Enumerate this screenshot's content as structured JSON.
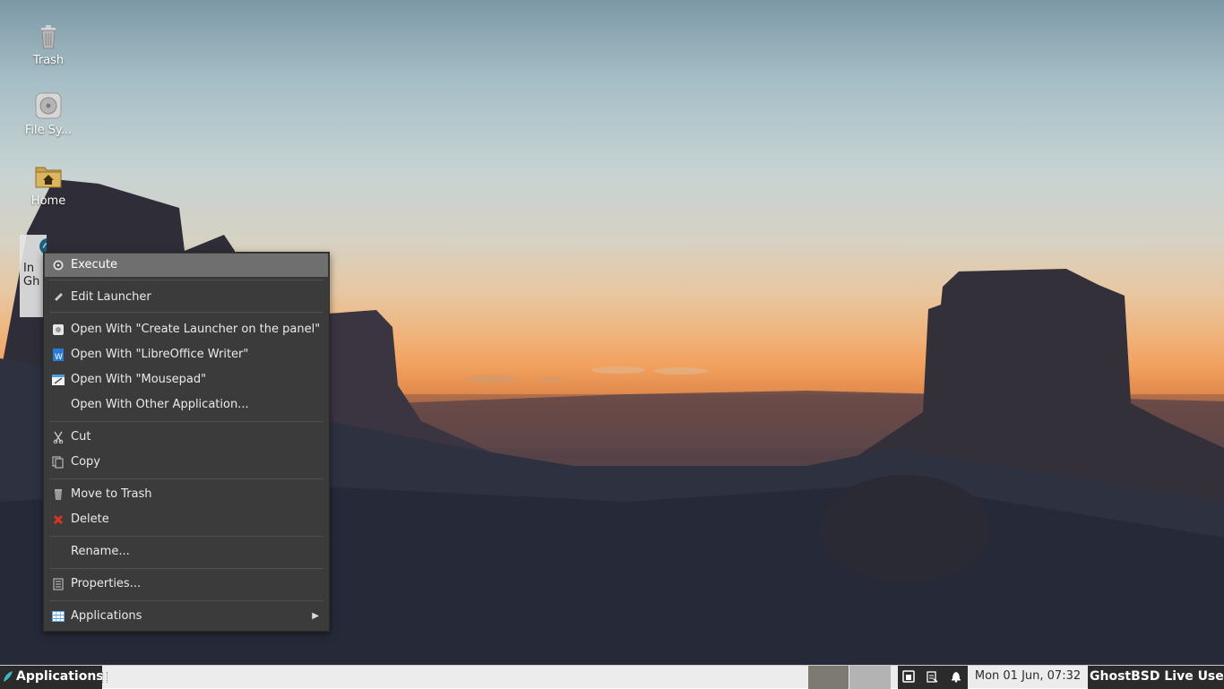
{
  "desktop": {
    "icons": [
      {
        "label": "Trash",
        "icon": "trash-icon"
      },
      {
        "label": "File Sy...",
        "icon": "filesystem-icon"
      },
      {
        "label": "Home",
        "icon": "home-folder-icon"
      },
      {
        "label": "In\nGh",
        "icon": "installer-icon"
      }
    ]
  },
  "context_menu": {
    "items": [
      {
        "label": "Execute",
        "icon": "gear-icon",
        "highlighted": true
      },
      {
        "label": "Edit Launcher",
        "icon": "pencil-icon"
      },
      {
        "label": "Open With \"Create Launcher on the panel\"",
        "icon": "launcher-icon"
      },
      {
        "label": "Open With \"LibreOffice Writer\"",
        "icon": "writer-icon"
      },
      {
        "label": "Open With \"Mousepad\"",
        "icon": "mousepad-icon"
      },
      {
        "label": "Open With Other Application...",
        "icon": ""
      },
      {
        "label": "Cut",
        "icon": "scissors-icon"
      },
      {
        "label": "Copy",
        "icon": "copy-icon"
      },
      {
        "label": "Move to Trash",
        "icon": "trash-icon"
      },
      {
        "label": "Delete",
        "icon": "delete-icon"
      },
      {
        "label": "Rename...",
        "icon": ""
      },
      {
        "label": "Properties...",
        "icon": "properties-icon"
      },
      {
        "label": "Applications",
        "icon": "applications-grid-icon",
        "submenu": true
      }
    ]
  },
  "taskbar": {
    "applications_label": "Applications",
    "clock": "Mon 01 Jun, 07:32",
    "user": "GhostBSD Live User",
    "tray_icons": [
      "network-icon",
      "clipboard-icon",
      "notification-bell-icon"
    ]
  },
  "colors": {
    "menu_bg": "#3b3b3b",
    "menu_highlight": "#6f6f6f",
    "panel_dark": "#2b2b2b",
    "panel_light": "#ececec"
  }
}
